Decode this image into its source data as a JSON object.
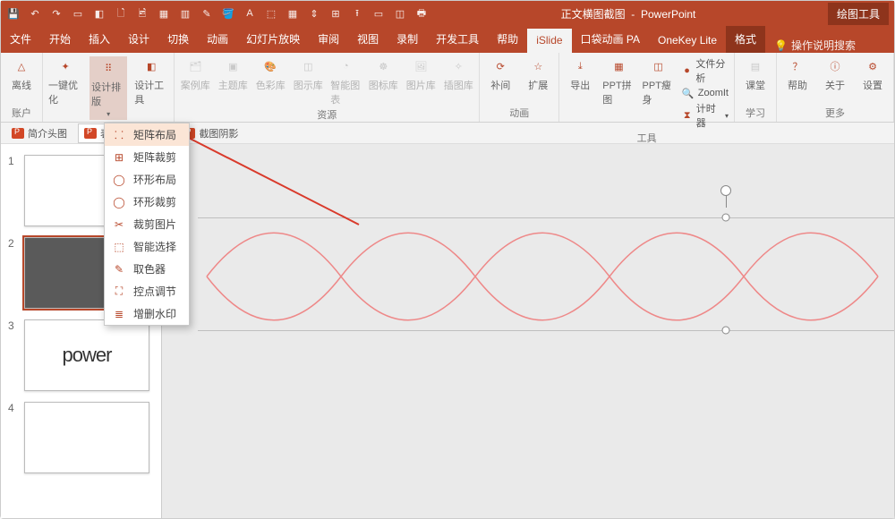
{
  "titlebar": {
    "doc": "正文横图截图",
    "app": "PowerPoint",
    "context": "绘图工具"
  },
  "tabs": [
    "文件",
    "开始",
    "插入",
    "设计",
    "切换",
    "动画",
    "幻灯片放映",
    "审阅",
    "视图",
    "录制",
    "开发工具",
    "帮助"
  ],
  "tab_islide": "iSlide",
  "tabs2": [
    "口袋动画 PA",
    "OneKey Lite"
  ],
  "tab_format": "格式",
  "tell": "操作说明搜索",
  "ribbon": {
    "account": {
      "btn": "离线",
      "name": "账户"
    },
    "design": {
      "opt": "一键优化",
      "layout": "设计排版",
      "tools": "设计工具",
      "name": "设计"
    },
    "resources": {
      "items": [
        "案例库",
        "主题库",
        "色彩库",
        "图示库",
        "智能图表",
        "图标库",
        "图片库",
        "插图库"
      ],
      "name": "资源"
    },
    "anim": {
      "items": [
        "补间",
        "扩展"
      ],
      "name": "动画"
    },
    "tools": {
      "export": "导出",
      "pptpj": "PPT拼图",
      "pptss": "PPT瘦身",
      "fa": "文件分析",
      "zoom": "ZoomIt",
      "timer": "计时器",
      "name": "工具"
    },
    "learn": {
      "btn": "课堂",
      "name": "学习"
    },
    "more": {
      "items": [
        "帮助",
        "关于",
        "设置"
      ],
      "name": "更多"
    }
  },
  "docs": {
    "d1": "简介头图",
    "d2": "表面截图",
    "d3": "截图阴影"
  },
  "dropdown": [
    "矩阵布局",
    "矩阵裁剪",
    "环形布局",
    "环形裁剪",
    "裁剪图片",
    "智能选择",
    "取色器",
    "控点调节",
    "增删水印"
  ],
  "thumbs": {
    "s3": "power"
  }
}
